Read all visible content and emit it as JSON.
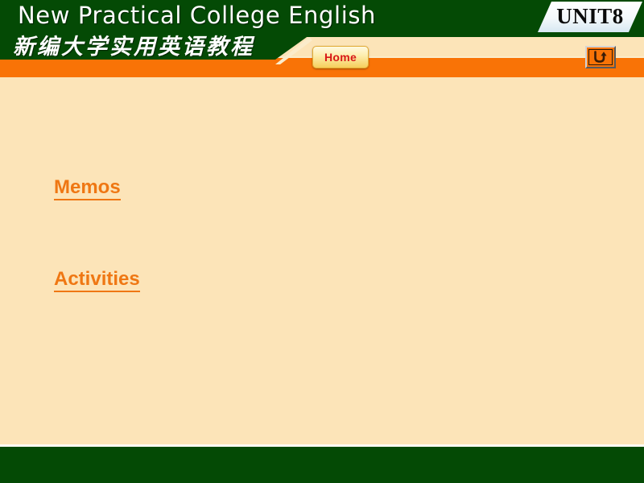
{
  "slide": {
    "background_color": "#fce4b8",
    "header": {
      "green_color": "#044a05",
      "orange_color": "#f97306",
      "title_en": "New Practical College English",
      "title_cn": "新编大学实用英语教程",
      "unit_badge": "UNIT8",
      "home_button": "Home",
      "return_button_icon": "return-arrow-icon"
    },
    "content": {
      "links": [
        {
          "label": "Memos"
        },
        {
          "label": "Activities"
        }
      ],
      "link_color": "#ef7713"
    },
    "footer": {
      "color": "#044a05"
    }
  }
}
